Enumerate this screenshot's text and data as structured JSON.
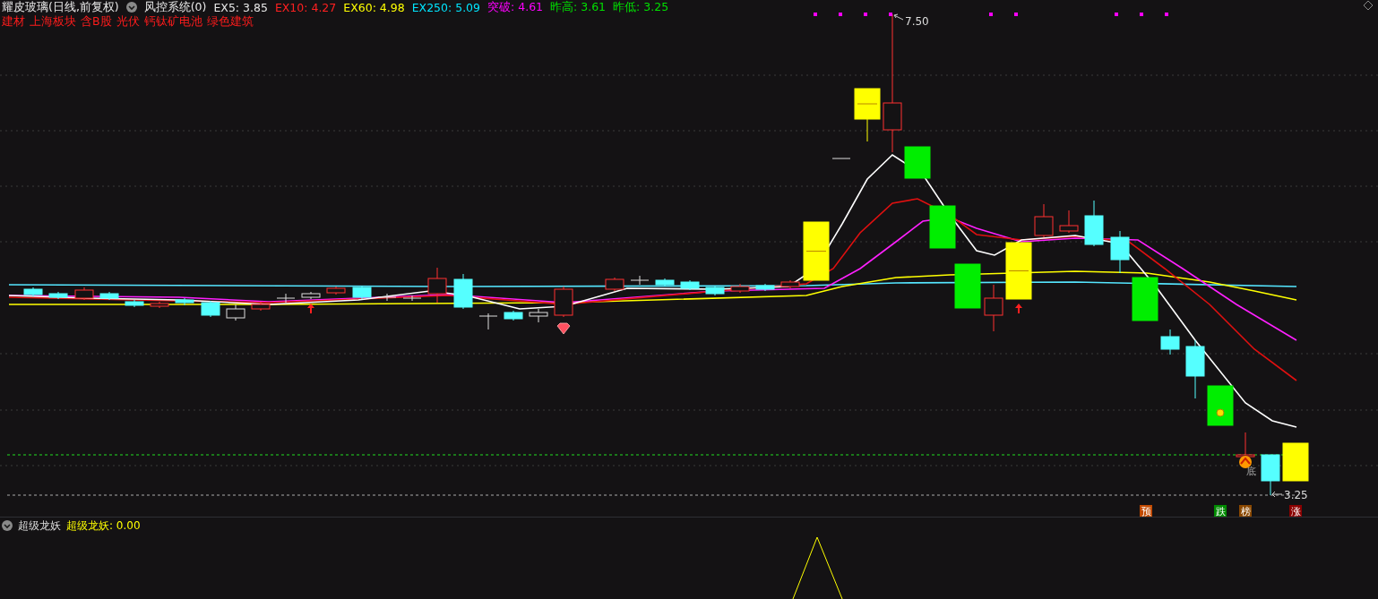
{
  "header": {
    "title": "耀皮玻璃(日线,前复权)",
    "system": "风控系统(0)",
    "indicators": [
      {
        "text": "EX5: 3.85",
        "color": "#e6e6e6"
      },
      {
        "text": "EX10: 4.27",
        "color": "#ff2020"
      },
      {
        "text": "EX60: 4.98",
        "color": "#ffff00"
      },
      {
        "text": "EX250: 5.09",
        "color": "#00e5ff"
      },
      {
        "text": "突破: 4.61",
        "color": "#ff00ff"
      },
      {
        "text": "昨高: 3.61",
        "color": "#00e000"
      },
      {
        "text": "昨低: 3.25",
        "color": "#00e000"
      }
    ]
  },
  "tags": [
    "建材",
    "上海板块",
    "含B股",
    "光伏",
    "钙钛矿电池",
    "绿色建筑"
  ],
  "chart": {
    "high_label": "7.50",
    "low_label": "3.25",
    "bottom_label": "底"
  },
  "signals": [
    {
      "text": "预",
      "color": "#c24a00"
    },
    {
      "text": "跌",
      "color": "#008a00"
    },
    {
      "text": "榜",
      "color": "#8a4800"
    },
    {
      "text": "涨",
      "color": "#8a0000"
    }
  ],
  "sub_panel": {
    "title": "超级龙妖",
    "reading": "超级龙妖: 0.00"
  }
}
